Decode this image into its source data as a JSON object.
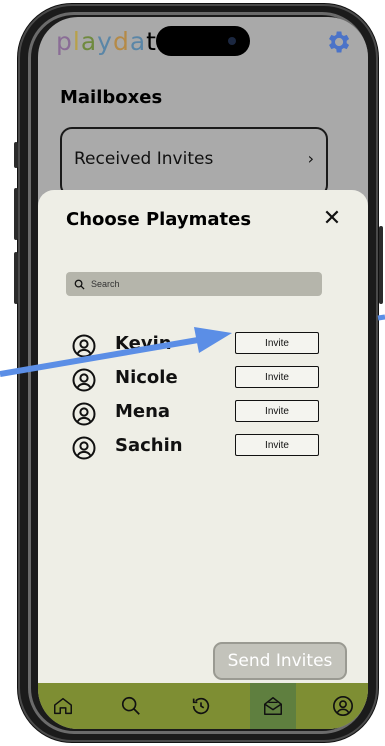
{
  "app": {
    "logo_letters": [
      "p",
      "l",
      "a",
      "y",
      "d",
      "a",
      "t"
    ],
    "page_title": "Mailboxes",
    "received_label": "Received Invites",
    "received_chevron": "›"
  },
  "sheet": {
    "title": "Choose Playmates",
    "close": "✕",
    "search_placeholder": "Search",
    "invite_label": "Invite",
    "send_label": "Send Invites",
    "playmates": [
      {
        "name": "Kevin"
      },
      {
        "name": "Nicole"
      },
      {
        "name": "Mena"
      },
      {
        "name": "Sachin"
      }
    ]
  },
  "tabs": [
    {
      "icon": "home-icon"
    },
    {
      "icon": "search-icon"
    },
    {
      "icon": "history-icon"
    },
    {
      "icon": "mailbox-icon",
      "active": true
    },
    {
      "icon": "profile-icon"
    }
  ],
  "colors": {
    "tabbar": "#7e8e33",
    "tab_active": "#5f7f3f",
    "sheet": "#eeeee6",
    "arrow": "#5b8ee6",
    "gear": "#4b73c8"
  },
  "annotations": [
    "arrow-left",
    "arrow-right"
  ]
}
